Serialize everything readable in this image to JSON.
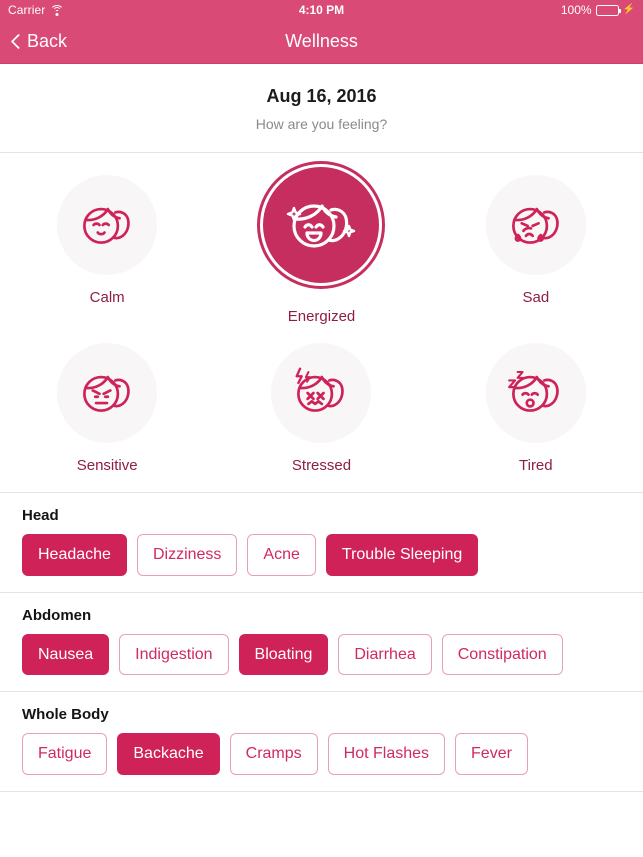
{
  "status_bar": {
    "carrier": "Carrier",
    "wifi_icon": "wifi-icon",
    "time": "4:10 PM",
    "battery_percent": "100%",
    "battery_icon": "battery-full-icon",
    "charging_icon": "lightning-bolt-icon"
  },
  "nav": {
    "back_label": "Back",
    "back_icon": "chevron-left-icon",
    "title": "Wellness"
  },
  "header": {
    "date": "Aug 16, 2016",
    "prompt": "How are you feeling?"
  },
  "moods": {
    "rows": [
      [
        {
          "label": "Calm",
          "icon": "mood-calm-icon",
          "selected": false
        },
        {
          "label": "Energized",
          "icon": "mood-energized-icon",
          "selected": true
        },
        {
          "label": "Sad",
          "icon": "mood-sad-icon",
          "selected": false
        }
      ],
      [
        {
          "label": "Sensitive",
          "icon": "mood-sensitive-icon",
          "selected": false
        },
        {
          "label": "Stressed",
          "icon": "mood-stressed-icon",
          "selected": false
        },
        {
          "label": "Tired",
          "icon": "mood-tired-icon",
          "selected": false
        }
      ]
    ]
  },
  "symptom_groups": [
    {
      "title": "Head",
      "chips": [
        {
          "label": "Headache",
          "selected": true
        },
        {
          "label": "Dizziness",
          "selected": false
        },
        {
          "label": "Acne",
          "selected": false
        },
        {
          "label": "Trouble Sleeping",
          "selected": true
        }
      ]
    },
    {
      "title": "Abdomen",
      "chips": [
        {
          "label": "Nausea",
          "selected": true
        },
        {
          "label": "Indigestion",
          "selected": false
        },
        {
          "label": "Bloating",
          "selected": true
        },
        {
          "label": "Diarrhea",
          "selected": false
        },
        {
          "label": "Constipation",
          "selected": false
        }
      ]
    },
    {
      "title": "Whole Body",
      "chips": [
        {
          "label": "Fatigue",
          "selected": false
        },
        {
          "label": "Backache",
          "selected": true
        },
        {
          "label": "Cramps",
          "selected": false
        },
        {
          "label": "Hot Flashes",
          "selected": false
        },
        {
          "label": "Fever",
          "selected": false
        }
      ]
    }
  ],
  "colors": {
    "nav_pink": "#D94A77",
    "accent_pink": "#CE2259",
    "selected_mood_pink": "#C62E60",
    "chip_border": "#E8A0B9",
    "mood_label": "#8E1F42",
    "circle_bg": "#F8F6F6",
    "battery_green": "#4CD964"
  }
}
